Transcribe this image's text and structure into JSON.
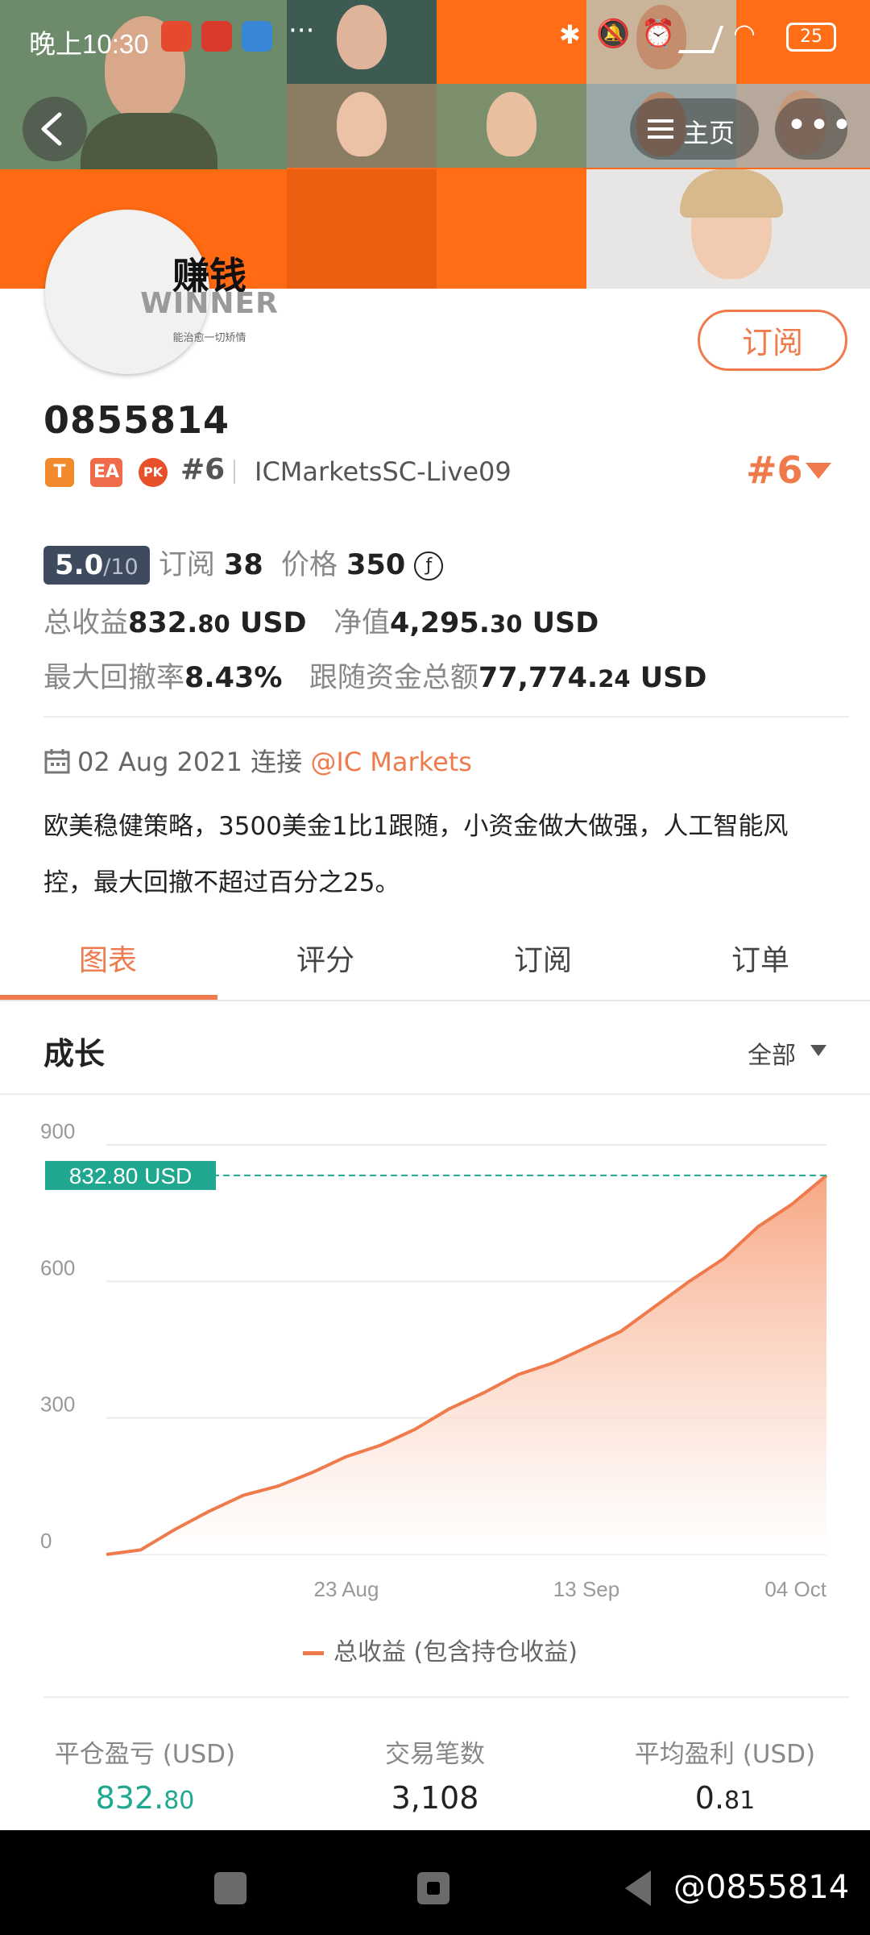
{
  "status_bar": {
    "time": "晚上10:30",
    "icons": [
      "app-icon",
      "app-icon",
      "app-icon",
      "more-icon",
      "bluetooth-icon",
      "mute-icon",
      "alarm-icon",
      "signal-icon",
      "wifi-icon",
      "battery-icon"
    ],
    "battery": "25"
  },
  "header": {
    "back_icon": "back-arrow-icon",
    "home_label": "主页",
    "more_icon": "more-icon"
  },
  "profile": {
    "avatar_text_1": "赚钱",
    "avatar_text_2": "WINNER",
    "avatar_text_3": "能治愈一切矫情",
    "subscribe_label": "订阅",
    "account_id": "0855814",
    "badges": [
      "T",
      "EA",
      "PK"
    ],
    "rank": "#6",
    "server": "ICMarketsSC-Live09",
    "rank_big": "#6"
  },
  "stats": {
    "rating": "5.0",
    "rating_denominator": "/10",
    "subscriptions_label": "订阅",
    "subscriptions_value": "38",
    "price_label": "价格",
    "price_value": "350",
    "price_icon": "ƒ",
    "total_profit_label": "总收益",
    "total_profit_int": "832.",
    "total_profit_dec": "80",
    "total_profit_unit": "USD",
    "equity_label": "净值",
    "equity_int": "4,295.",
    "equity_dec": "30",
    "equity_unit": "USD",
    "drawdown_label": "最大回撤率",
    "drawdown_value": "8.43%",
    "follow_funds_label": "跟随资金总额",
    "follow_funds_int": "77,774.",
    "follow_funds_dec": "24",
    "follow_funds_unit": "USD"
  },
  "connection": {
    "date": "02 Aug 2021 连接",
    "broker": "@IC Markets"
  },
  "description": "欧美稳健策略，3500美金1比1跟随，小资金做大做强，人工智能风控，最大回撤不超过百分之25。",
  "tabs": [
    "图表",
    "评分",
    "订阅",
    "订单"
  ],
  "active_tab": 0,
  "section": {
    "title": "成长",
    "filter": "全部"
  },
  "chart_data": {
    "type": "area",
    "y_ticks": [
      "900",
      "600",
      "300",
      "0"
    ],
    "ylim": [
      0,
      900
    ],
    "x_tick_labels": [
      "23 Aug",
      "13 Sep",
      "04 Oct"
    ],
    "current_value_label": "832.80 USD",
    "current_value": 832.8,
    "series": [
      {
        "name": "总收益 (包含持仓收益)",
        "x": [
          "02 Aug",
          "04 Aug",
          "07 Aug",
          "10 Aug",
          "13 Aug",
          "16 Aug",
          "19 Aug",
          "22 Aug",
          "25 Aug",
          "28 Aug",
          "31 Aug",
          "03 Sep",
          "06 Sep",
          "09 Sep",
          "12 Sep",
          "15 Sep",
          "18 Sep",
          "21 Sep",
          "24 Sep",
          "27 Sep",
          "30 Sep",
          "04 Oct"
        ],
        "values": [
          0,
          10,
          55,
          95,
          130,
          150,
          180,
          215,
          240,
          275,
          320,
          355,
          395,
          420,
          455,
          490,
          545,
          600,
          650,
          720,
          770,
          832.8
        ]
      }
    ],
    "colors": {
      "line": "#ef7a4c",
      "fill_top": "#f7a27c",
      "reference": "#1fa88f"
    }
  },
  "legend_label": "总收益 (包含持仓收益)",
  "summary": [
    {
      "label": "平仓盈亏 (USD)",
      "int": "832.",
      "dec": "80",
      "color": "#1fa88f"
    },
    {
      "label": "交易笔数",
      "int": "3,108",
      "dec": "",
      "color": "#222222"
    },
    {
      "label": "平均盈利 (USD)",
      "int": "0.",
      "dec": "81",
      "color": "#222222"
    }
  ],
  "nav_bar": {
    "icons": [
      "menu-icon",
      "home-icon",
      "back-icon"
    ],
    "watermark": "@0855814"
  }
}
